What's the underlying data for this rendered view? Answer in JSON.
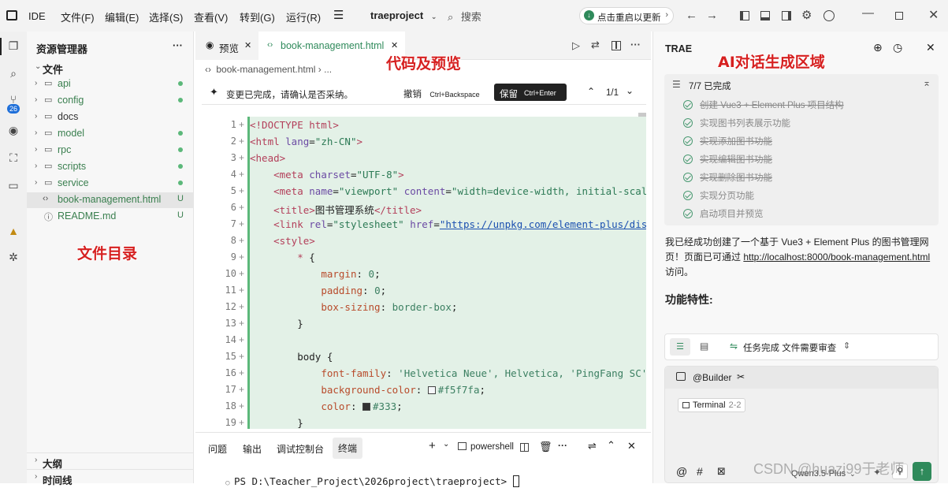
{
  "titlebar": {
    "app_label": "IDE",
    "menu": [
      "文件(F)",
      "编辑(E)",
      "选择(S)",
      "查看(V)",
      "转到(G)",
      "运行(R)"
    ],
    "project": "traeproject",
    "search": "搜索",
    "update_btn": "点击重启以更新"
  },
  "explorer": {
    "title": "资源管理器",
    "more": "···",
    "root": "文件",
    "items": [
      {
        "name": "api",
        "kind": "folder",
        "status": "dot"
      },
      {
        "name": "config",
        "kind": "folder",
        "status": "dot"
      },
      {
        "name": "docs",
        "kind": "folder",
        "status": ""
      },
      {
        "name": "model",
        "kind": "folder",
        "status": "dot"
      },
      {
        "name": "rpc",
        "kind": "folder",
        "status": "dot"
      },
      {
        "name": "scripts",
        "kind": "folder",
        "status": "dot"
      },
      {
        "name": "service",
        "kind": "folder",
        "status": "dot"
      },
      {
        "name": "book-management.html",
        "kind": "html",
        "status": "U"
      },
      {
        "name": "README.md",
        "kind": "md",
        "status": "U"
      }
    ],
    "outline": "大纲",
    "timeline": "时间线",
    "annotation": "文件目录"
  },
  "editor": {
    "tabs": [
      {
        "label": "预览",
        "icon": "eye-icon"
      },
      {
        "label": "book-management.html",
        "icon": "code-icon"
      }
    ],
    "breadcrumb": "book-management.html",
    "breadcrumb_more": "...",
    "notice": "变更已完成，请确认是否采纳。",
    "undo_label": "撤销",
    "undo_shortcut": "Ctrl+Backspace",
    "keep_label": "保留",
    "keep_shortcut": "Ctrl+Enter",
    "change_counter": "1/1",
    "annotation": "代码及预览",
    "line_numbers": [
      "1",
      "2",
      "3",
      "4",
      "5",
      "6",
      "7",
      "8",
      "9",
      "10",
      "11",
      "12",
      "13",
      "14",
      "15",
      "16",
      "17",
      "18",
      "19"
    ],
    "code": {
      "l1": "<!DOCTYPE html>",
      "l2_open": "<html ",
      "l2_attr": "lang",
      "l2_val": "\"zh-CN\"",
      "l2_close": ">",
      "l3": "<head>",
      "l4_open": "<meta ",
      "l4_attr": "charset",
      "l4_val": "\"UTF-8\"",
      "l4_close": ">",
      "l5_open": "<meta ",
      "l5_attr1": "name",
      "l5_val1": "\"viewport\"",
      "l5_attr2": "content",
      "l5_val2": "\"width=device-width, initial-scale",
      "l6_open": "<title>",
      "l6_text": "图书管理系统",
      "l6_close": "</title>",
      "l7_open": "<link ",
      "l7_attr1": "rel",
      "l7_val1": "\"stylesheet\"",
      "l7_attr2": "href",
      "l7_val2": "\"https://unpkg.com/element-plus/dist",
      "l8": "<style>",
      "l9_sel": "* ",
      "l9_brace": "{",
      "l10_prop": "margin",
      "l10_val": "0",
      "l11_prop": "padding",
      "l11_val": "0",
      "l12_prop": "box-sizing",
      "l12_val": "border-box",
      "l13": "}",
      "l15_sel": "body ",
      "l15_brace": "{",
      "l16_prop": "font-family",
      "l16_val": "'Helvetica Neue', Helvetica, 'PingFang SC',",
      "l17_prop": "background-color",
      "l17_val": "#f5f7fa",
      "l18_prop": "color",
      "l18_val": "#333",
      "l19": "}"
    }
  },
  "terminal": {
    "tabs": [
      "问题",
      "输出",
      "调试控制台",
      "终端"
    ],
    "shell": "powershell",
    "prompt": "PS D:\\Teacher_Project\\2026project\\traeproject> "
  },
  "chat": {
    "title": "TRAE",
    "annotation": "AI对话生成区域",
    "todo_summary": "7/7 已完成",
    "todos": [
      "创建 Vue3 + Element Plus 项目结构",
      "实现图书列表展示功能",
      "实现添加图书功能",
      "实现编辑图书功能",
      "实现删除图书功能",
      "实现分页功能",
      "启动项目并预览"
    ],
    "message_part1": "我已经成功创建了一个基于 Vue3 + Element Plus 的图书管理网页！页面已可通过 ",
    "message_link": "http://localhost:8000/book-management.html",
    "message_part2": " 访问。",
    "features_heading": "功能特性:",
    "task_status": "任务完成 文件需要审查",
    "agent": "@Builder",
    "context_chip": "Terminal",
    "context_range": "2-2",
    "model": "Qwen3.5-Plus"
  },
  "watermark": "CSDN @huazi99于老师",
  "colors": {
    "accent_green": "#2f8a5b",
    "annotation_red": "#d62020",
    "diff_bg": "#e3f1e7"
  }
}
